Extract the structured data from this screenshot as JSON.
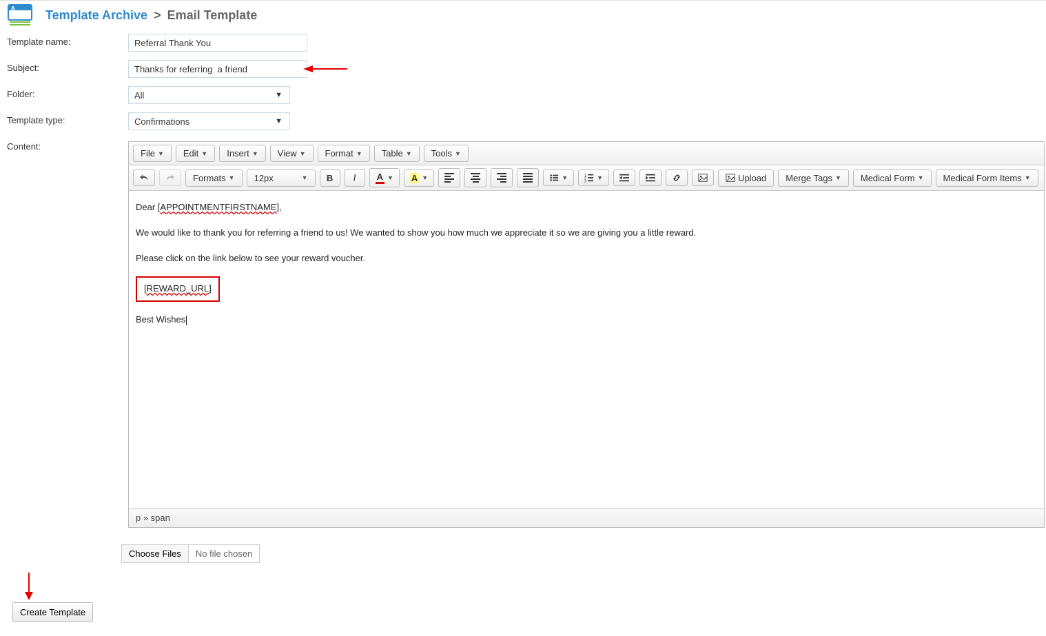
{
  "breadcrumb": {
    "root": "Template Archive",
    "sep": ">",
    "current": "Email Template"
  },
  "labels": {
    "template_name": "Template name:",
    "subject": "Subject:",
    "folder": "Folder:",
    "template_type": "Template type:",
    "content": "Content:"
  },
  "values": {
    "template_name": "Referral Thank You",
    "subject": "Thanks for referring  a friend",
    "folder": "All",
    "template_type": "Confirmations"
  },
  "editor": {
    "menubar": [
      "File",
      "Edit",
      "Insert",
      "View",
      "Format",
      "Table",
      "Tools"
    ],
    "toolbar": {
      "formats": "Formats",
      "fontsize": "12px",
      "upload": "Upload",
      "merge_tags": "Merge Tags",
      "medical_form": "Medical Form",
      "medical_form_items": "Medical Form Items"
    },
    "content": {
      "greeting_prefix": "Dear [",
      "greeting_token": "APPOINTMENTFIRSTNAME",
      "greeting_suffix": "],",
      "line1": "We would like to thank you for referring a friend to us! We wanted to show you how much we appreciate it so we are giving you a little reward.",
      "line2": "Please click on the link below to see your reward voucher.",
      "reward_prefix": "[",
      "reward_token": "REWARD_URL",
      "reward_suffix": "]",
      "closing": "Best Wishes"
    },
    "statusbar": "p » span"
  },
  "file": {
    "button": "Choose Files",
    "status": "No file chosen"
  },
  "actions": {
    "create": "Create Template"
  }
}
